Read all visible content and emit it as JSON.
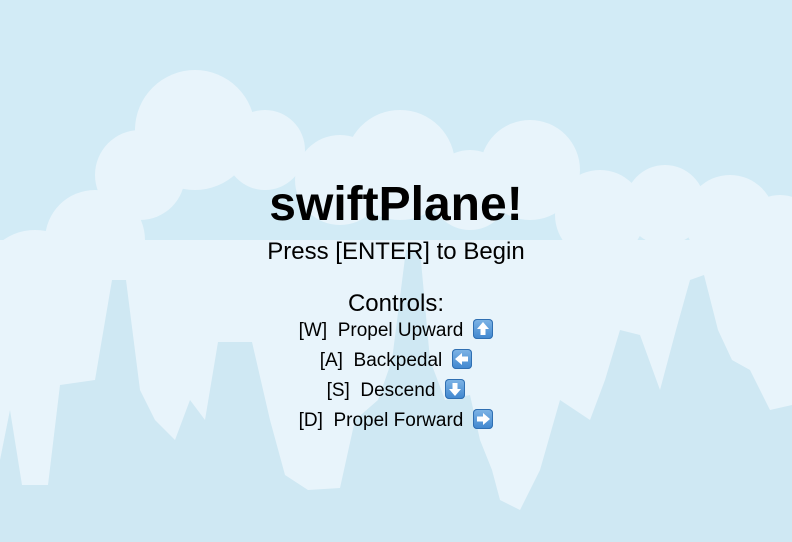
{
  "game": {
    "title": "swiftPlane!",
    "start_prompt": "Press [ENTER] to Begin",
    "controls_heading": "Controls:",
    "controls": [
      {
        "key": "[W]",
        "action": "Propel Upward",
        "icon": "up-arrow-icon"
      },
      {
        "key": "[A]",
        "action": "Backpedal",
        "icon": "left-arrow-icon"
      },
      {
        "key": "[S]",
        "action": "Descend",
        "icon": "down-arrow-icon"
      },
      {
        "key": "[D]",
        "action": "Propel Forward",
        "icon": "right-arrow-icon"
      }
    ]
  },
  "colors": {
    "sky": "#d2ebf6",
    "cloud": "#e8f4fb",
    "skyline": "#cfe8f3",
    "arrow_key": "#3f86cf"
  }
}
